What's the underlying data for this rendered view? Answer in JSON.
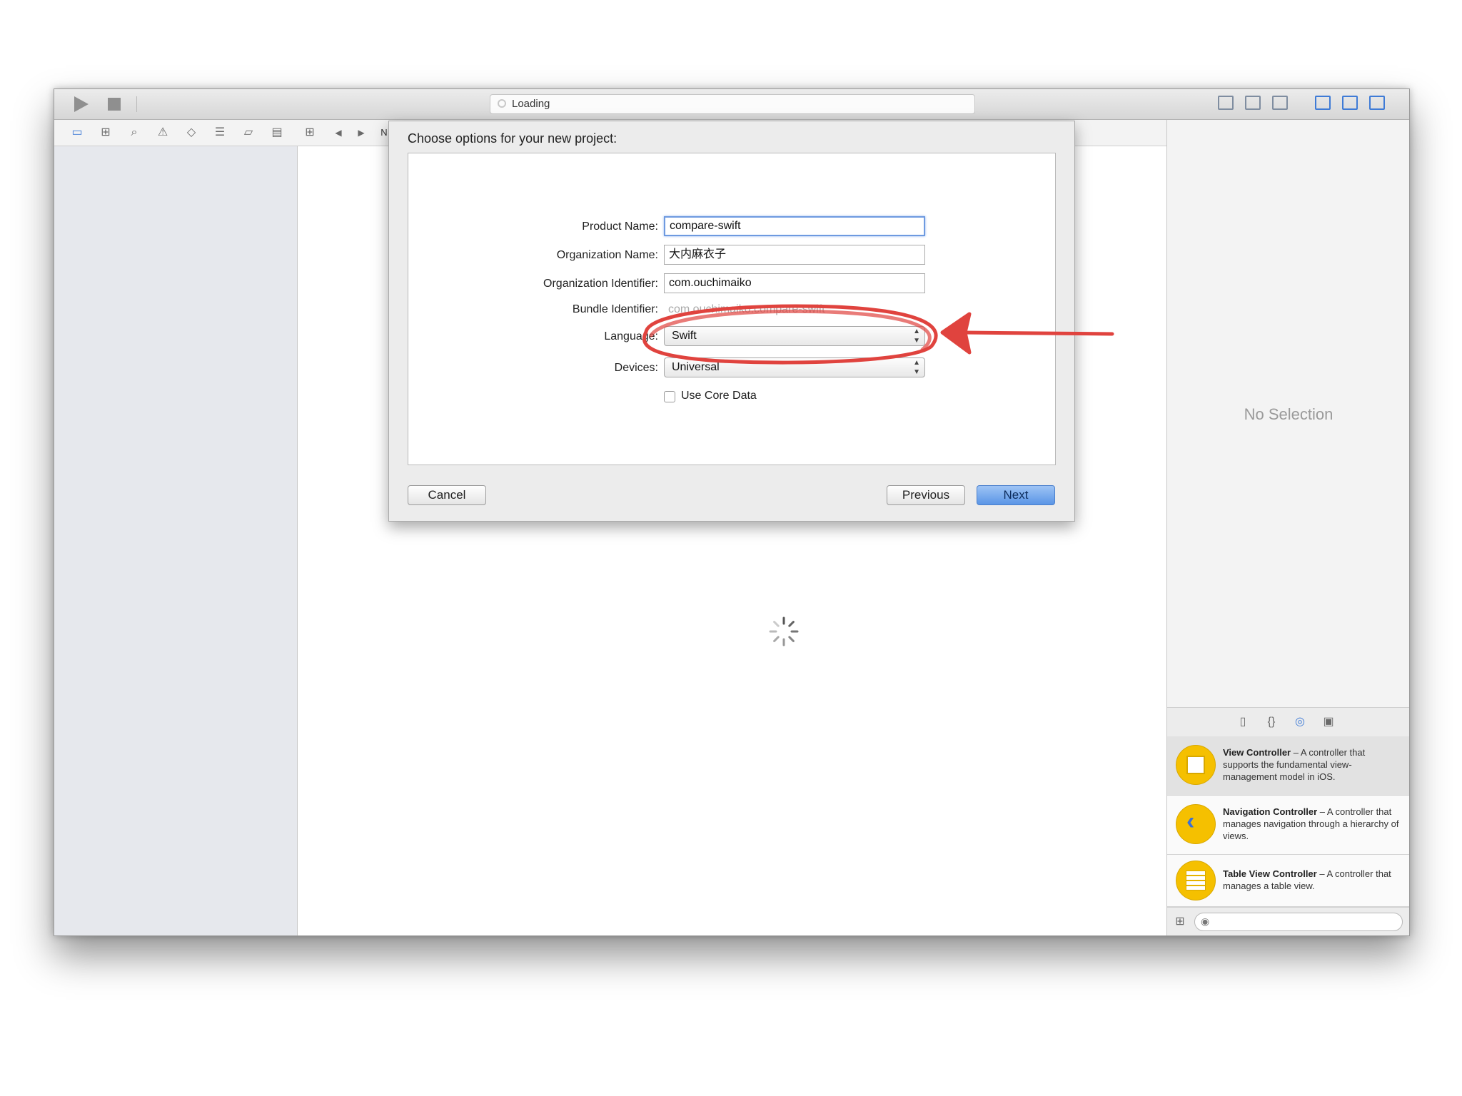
{
  "toolbar": {
    "activity_text": "Loading",
    "navigator_partial_label": "N"
  },
  "dialog": {
    "title": "Choose options for your new project:",
    "fields": {
      "product_name_label": "Product Name:",
      "product_name_value": "compare-swift",
      "organization_name_label": "Organization Name:",
      "organization_name_value": "大内麻衣子",
      "organization_identifier_label": "Organization Identifier:",
      "organization_identifier_value": "com.ouchimaiko",
      "bundle_identifier_label": "Bundle Identifier:",
      "bundle_identifier_value": "com.ouchimaiko.compare-swift",
      "language_label": "Language:",
      "language_value": "Swift",
      "devices_label": "Devices:",
      "devices_value": "Universal",
      "core_data_label": "Use Core Data"
    },
    "buttons": {
      "cancel": "Cancel",
      "previous": "Previous",
      "next": "Next"
    }
  },
  "inspector": {
    "empty_text": "No Selection"
  },
  "library": {
    "items": [
      {
        "name": "View Controller",
        "desc": " – A controller that supports the fundamental view-management model in iOS."
      },
      {
        "name": "Navigation Controller",
        "desc": " – A controller that manages navigation through a hierarchy of views."
      },
      {
        "name": "Table View Controller",
        "desc": " – A controller that manages a table view."
      }
    ]
  },
  "annotation": {
    "color": "#e0433e"
  }
}
